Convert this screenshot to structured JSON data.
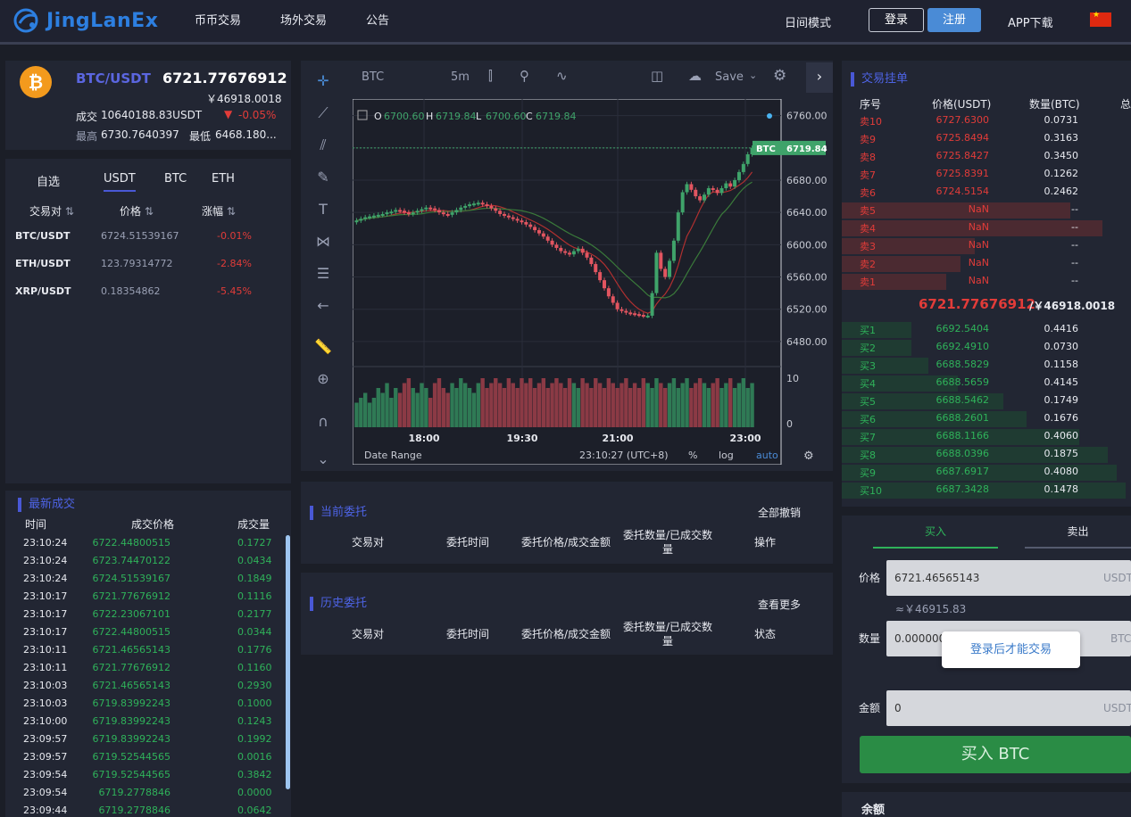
{
  "nav": {
    "logo_text": "JingLanEx",
    "items": [
      "币币交易",
      "场外交易",
      "公告"
    ],
    "day_mode": "日间模式",
    "login": "登录",
    "register": "注册",
    "app": "APP下载"
  },
  "ticker": {
    "pair": "BTC/USDT",
    "price": "6721.77676912",
    "cny": "￥46918.0018",
    "volume_label": "成交",
    "volume": "10640188.83USDT",
    "change": "-0.05%",
    "high_label": "最高",
    "high": "6730.7640397",
    "low_label": "最低",
    "low": "6468.180..."
  },
  "market": {
    "tabs": [
      "自选",
      "USDT",
      "BTC",
      "ETH"
    ],
    "active_tab": "USDT",
    "headers": [
      "交易对",
      "价格",
      "涨幅"
    ],
    "rows": [
      {
        "pair": "BTC/USDT",
        "price": "6724.51539167",
        "change": "-0.01%"
      },
      {
        "pair": "ETH/USDT",
        "price": "123.79314772",
        "change": "-2.84%"
      },
      {
        "pair": "XRP/USDT",
        "price": "0.18354862",
        "change": "-5.45%"
      }
    ]
  },
  "trades": {
    "title": "最新成交",
    "headers": [
      "时间",
      "成交价格",
      "成交量"
    ],
    "rows": [
      [
        "23:10:24",
        "6722.44800515",
        "0.1727"
      ],
      [
        "23:10:24",
        "6723.74470122",
        "0.0434"
      ],
      [
        "23:10:24",
        "6724.51539167",
        "0.1849"
      ],
      [
        "23:10:17",
        "6721.77676912",
        "0.1116"
      ],
      [
        "23:10:17",
        "6722.23067101",
        "0.2177"
      ],
      [
        "23:10:17",
        "6722.44800515",
        "0.0344"
      ],
      [
        "23:10:11",
        "6721.46565143",
        "0.1776"
      ],
      [
        "23:10:11",
        "6721.77676912",
        "0.1160"
      ],
      [
        "23:10:03",
        "6721.46565143",
        "0.2930"
      ],
      [
        "23:10:03",
        "6719.83992243",
        "0.1000"
      ],
      [
        "23:10:00",
        "6719.83992243",
        "0.1243"
      ],
      [
        "23:09:57",
        "6719.83992243",
        "0.1992"
      ],
      [
        "23:09:57",
        "6719.52544565",
        "0.0016"
      ],
      [
        "23:09:54",
        "6719.52544565",
        "0.3842"
      ],
      [
        "23:09:54",
        "6719.2778846",
        "0.0000"
      ],
      [
        "23:09:44",
        "6719.2778846",
        "0.0642"
      ]
    ]
  },
  "chart_toolbar": {
    "symbol": "BTC",
    "interval": "5m",
    "save": "Save"
  },
  "chart_data": {
    "type": "candlestick",
    "ohlc_legend": {
      "o": "6700.60",
      "h": "6719.84",
      "l": "6700.60",
      "c": "6719.84"
    },
    "price_ticks": [
      "6760.00",
      "6720.00",
      "6680.00",
      "6640.00",
      "6600.00",
      "6560.00",
      "6520.00",
      "6480.00"
    ],
    "volume_ticks": [
      "10",
      "0"
    ],
    "time_ticks": [
      "18:00",
      "19:30",
      "21:00",
      "23:00"
    ],
    "last_label": "BTC",
    "last_price": "6719.84",
    "ylim": [
      6460,
      6775
    ],
    "closes": [
      6630,
      6632,
      6634,
      6635,
      6636,
      6637,
      6638,
      6640,
      6641,
      6643,
      6642,
      6640,
      6638,
      6640,
      6642,
      6644,
      6646,
      6645,
      6643,
      6640,
      6638,
      6637,
      6640,
      6643,
      6646,
      6648,
      6650,
      6651,
      6652,
      6650,
      6648,
      6645,
      6642,
      6638,
      6636,
      6634,
      6632,
      6630,
      6628,
      6625,
      6622,
      6618,
      6614,
      6610,
      6605,
      6600,
      6596,
      6592,
      6590,
      6588,
      6592,
      6595,
      6590,
      6584,
      6576,
      6566,
      6556,
      6546,
      6536,
      6528,
      6520,
      6518,
      6516,
      6515,
      6514,
      6513,
      6512,
      6512,
      6540,
      6590,
      6570,
      6560,
      6580,
      6605,
      6640,
      6665,
      6675,
      6668,
      6660,
      6655,
      6662,
      6670,
      6668,
      6664,
      6670,
      6676,
      6672,
      6680,
      6690,
      6700,
      6712,
      6720
    ],
    "volumes": [
      5,
      6,
      7,
      5,
      6,
      8,
      7,
      9,
      6,
      8,
      7,
      9,
      10,
      8,
      7,
      9,
      8,
      6,
      9,
      10,
      8,
      7,
      9,
      8,
      10,
      9,
      8,
      7,
      9,
      10,
      8,
      9,
      10,
      9,
      8,
      10,
      9,
      8,
      10,
      9,
      10,
      8,
      9,
      10,
      8,
      9,
      10,
      9,
      8,
      10,
      9,
      8,
      10,
      9,
      8,
      10,
      9,
      8,
      10,
      9,
      8,
      9,
      10,
      8,
      9,
      8,
      10,
      9,
      8,
      10,
      9,
      8,
      9,
      10,
      8,
      9,
      10,
      8,
      9,
      10,
      9,
      8,
      9,
      10,
      8,
      9,
      10,
      8,
      9,
      10,
      8,
      9
    ],
    "bottom_bar": {
      "date_range": "Date Range",
      "time": "23:10:27 (UTC+8)",
      "pct": "%",
      "log": "log",
      "auto": "auto"
    }
  },
  "orders": {
    "current_title": "当前委托",
    "cancel_all": "全部撤销",
    "history_title": "历史委托",
    "more": "查看更多",
    "headers": [
      "交易对",
      "委托时间",
      "委托价格/成交金额",
      "委托数量/已成交数量",
      "操作"
    ],
    "history_headers": [
      "交易对",
      "委托时间",
      "委托价格/成交金额",
      "委托数量/已成交数量",
      "状态"
    ]
  },
  "book": {
    "title": "交易挂单",
    "headers": [
      "序号",
      "价格(USDT)",
      "数量(BTC)",
      "总"
    ],
    "asks": [
      [
        "卖10",
        "6727.6300",
        "0.0731"
      ],
      [
        "卖9",
        "6725.8494",
        "0.3163"
      ],
      [
        "卖8",
        "6725.8427",
        "0.3450"
      ],
      [
        "卖7",
        "6725.8391",
        "0.1262"
      ],
      [
        "卖6",
        "6724.5154",
        "0.2462"
      ],
      [
        "卖5",
        "NaN",
        "--"
      ],
      [
        "卖4",
        "NaN",
        "--"
      ],
      [
        "卖3",
        "NaN",
        "--"
      ],
      [
        "卖2",
        "NaN",
        "--"
      ],
      [
        "卖1",
        "NaN",
        "--"
      ]
    ],
    "mid_price": "6721.77676912",
    "mid_cny": "/￥46918.0018",
    "bids": [
      [
        "买1",
        "6692.5404",
        "0.4416"
      ],
      [
        "买2",
        "6692.4910",
        "0.0730"
      ],
      [
        "买3",
        "6688.5829",
        "0.1158"
      ],
      [
        "买4",
        "6688.5659",
        "0.4145"
      ],
      [
        "买5",
        "6688.5462",
        "0.1749"
      ],
      [
        "买6",
        "6688.2601",
        "0.1676"
      ],
      [
        "买7",
        "6688.1166",
        "0.4060"
      ],
      [
        "买8",
        "6688.0396",
        "0.1875"
      ],
      [
        "买9",
        "6687.6917",
        "0.4080"
      ],
      [
        "买10",
        "6687.3428",
        "0.1478"
      ]
    ]
  },
  "trade_form": {
    "tab_buy": "买入",
    "tab_sell": "卖出",
    "price_label": "价格",
    "price_value": "6721.46565143",
    "price_unit": "USDT",
    "approx": "≈￥46915.83",
    "qty_label": "数量",
    "qty_value": "0.000000",
    "qty_unit": "BTC",
    "login_hint": "登录后才能交易",
    "amount_label": "金额",
    "amount_value": "0",
    "amount_unit": "USDT",
    "buy_button": "买入 BTC",
    "balance": "余额"
  },
  "colors": {
    "up": "#2fb25a",
    "down": "#e23c39",
    "accent": "#4958d6"
  }
}
